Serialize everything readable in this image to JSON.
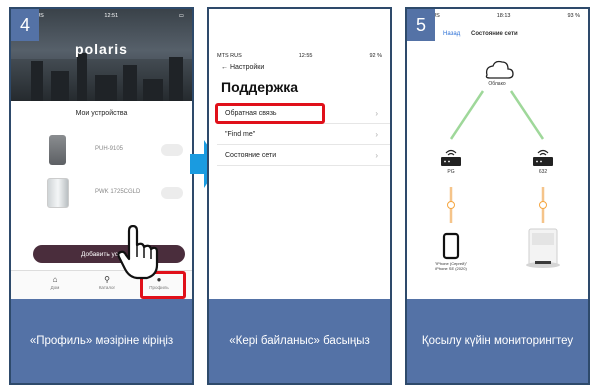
{
  "panel1": {
    "step": "4",
    "status": {
      "carrier": "MTS RUS",
      "time": "12:51"
    },
    "brand": "polaris",
    "section_title": "Мои устройства",
    "devices": [
      {
        "name": "PUH-9105"
      },
      {
        "name": "PWK 1725CGLD"
      }
    ],
    "add_button": "Добавить устр",
    "tabs": [
      {
        "label": "Дом"
      },
      {
        "label": "Каталог"
      },
      {
        "label": "Профиль"
      }
    ],
    "caption": "«Профиль» мәзіріне кіріңіз",
    "colors": {
      "highlight": "#e0101a",
      "caption_bg": "#5472a6"
    }
  },
  "panel2": {
    "status": {
      "carrier": "MTS RUS",
      "time": "12:55",
      "battery": "92 %"
    },
    "back_label": "Настройки",
    "title": "Поддержка",
    "menu": [
      {
        "label": "Обратная связь"
      },
      {
        "label": "\"Find me\""
      },
      {
        "label": "Состояние сети"
      }
    ],
    "caption": "«Кері байланыс» басыңыз"
  },
  "panel3": {
    "step": "5",
    "status": {
      "carrier": "MTS RUS",
      "time": "18:13",
      "battery": "93 %"
    },
    "back_label": "Назад",
    "title": "Состояние сети",
    "cloud_label": "Облако",
    "routers": [
      {
        "label": "PG"
      },
      {
        "label": "632"
      }
    ],
    "phone_label_1": "\"iPhone (Сергей)\"",
    "phone_label_2": "iPhone SE (2020)",
    "caption": "Қосылу күйін мониторингтеу",
    "colors": {
      "link_green": "#9fd89a",
      "link_orange": "#f5c48a"
    }
  }
}
